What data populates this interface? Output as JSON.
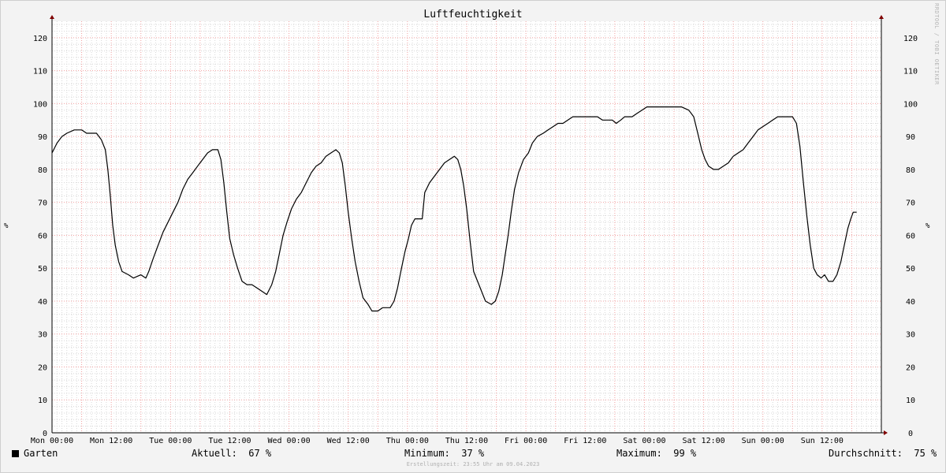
{
  "page": {
    "title": "Luftfeuchtigkeit",
    "watermark": "RRDTOOL / TOBI OETIKER",
    "unit": "%",
    "footer": "Erstellungszeit: 23:55 Uhr am 09.04.2023"
  },
  "legend": {
    "series": "Garten",
    "current_label": "Aktuell:",
    "current_value": "67 %",
    "min_label": "Minimum:",
    "min_value": "37 %",
    "max_label": "Maximum:",
    "max_value": "99 %",
    "avg_label": "Durchschnitt:",
    "avg_value": "75 %"
  },
  "colors": {
    "line": "#000000",
    "grid_minor": "#d8d8d8",
    "grid_major": "#f0a0a0",
    "axis_arrow": "#800000",
    "plot_bg": "#ffffff",
    "page_bg": "#f3f3f3"
  },
  "chart_data": {
    "type": "line",
    "title": "Luftfeuchtigkeit",
    "ylabel": "%",
    "ylim": [
      0,
      125
    ],
    "yticks": [
      0,
      10,
      20,
      30,
      40,
      50,
      60,
      70,
      80,
      90,
      100,
      110,
      120
    ],
    "xlim_hours": [
      0,
      168
    ],
    "xticks": [
      {
        "h": 0,
        "label": "Mon 00:00"
      },
      {
        "h": 12,
        "label": "Mon 12:00"
      },
      {
        "h": 24,
        "label": "Tue 00:00"
      },
      {
        "h": 36,
        "label": "Tue 12:00"
      },
      {
        "h": 48,
        "label": "Wed 00:00"
      },
      {
        "h": 60,
        "label": "Wed 12:00"
      },
      {
        "h": 72,
        "label": "Thu 00:00"
      },
      {
        "h": 84,
        "label": "Thu 12:00"
      },
      {
        "h": 96,
        "label": "Fri 00:00"
      },
      {
        "h": 108,
        "label": "Fri 12:00"
      },
      {
        "h": 120,
        "label": "Sat 00:00"
      },
      {
        "h": 132,
        "label": "Sat 12:00"
      },
      {
        "h": 144,
        "label": "Sun 00:00"
      },
      {
        "h": 156,
        "label": "Sun 12:00"
      }
    ],
    "grid": true,
    "series": [
      {
        "name": "Garten",
        "points": [
          [
            0,
            85
          ],
          [
            1,
            88
          ],
          [
            2,
            90
          ],
          [
            3,
            91
          ],
          [
            4.5,
            92
          ],
          [
            6,
            92
          ],
          [
            7,
            91
          ],
          [
            9,
            91
          ],
          [
            10,
            89
          ],
          [
            10.8,
            86
          ],
          [
            11.3,
            80
          ],
          [
            11.8,
            72
          ],
          [
            12.3,
            63
          ],
          [
            12.8,
            57
          ],
          [
            13.5,
            52
          ],
          [
            14.2,
            49
          ],
          [
            15.5,
            48
          ],
          [
            16.5,
            47
          ],
          [
            18,
            48
          ],
          [
            19,
            47
          ],
          [
            19.6,
            49
          ],
          [
            20.5,
            53
          ],
          [
            21.5,
            57
          ],
          [
            22.5,
            61
          ],
          [
            23.5,
            64
          ],
          [
            24.5,
            67
          ],
          [
            25.5,
            70
          ],
          [
            26.5,
            74
          ],
          [
            27.5,
            77
          ],
          [
            28.5,
            79
          ],
          [
            29.5,
            81
          ],
          [
            30.5,
            83
          ],
          [
            31.5,
            85
          ],
          [
            32.5,
            86
          ],
          [
            33.6,
            86
          ],
          [
            34.2,
            83
          ],
          [
            34.8,
            76
          ],
          [
            35.4,
            67
          ],
          [
            36,
            59
          ],
          [
            36.8,
            54
          ],
          [
            37.6,
            50
          ],
          [
            38.5,
            46
          ],
          [
            39.5,
            45
          ],
          [
            40.5,
            45
          ],
          [
            41.5,
            44
          ],
          [
            42.5,
            43
          ],
          [
            43.5,
            42
          ],
          [
            44.5,
            45
          ],
          [
            45.3,
            49
          ],
          [
            46,
            54
          ],
          [
            46.8,
            60
          ],
          [
            47.6,
            64
          ],
          [
            48.5,
            68
          ],
          [
            49.5,
            71
          ],
          [
            50.5,
            73
          ],
          [
            51.5,
            76
          ],
          [
            52.5,
            79
          ],
          [
            53.5,
            81
          ],
          [
            54.5,
            82
          ],
          [
            55.5,
            84
          ],
          [
            56.5,
            85
          ],
          [
            57.5,
            86
          ],
          [
            58.2,
            85
          ],
          [
            58.8,
            82
          ],
          [
            59.4,
            75
          ],
          [
            60,
            67
          ],
          [
            60.7,
            59
          ],
          [
            61.4,
            52
          ],
          [
            62.2,
            46
          ],
          [
            63,
            41
          ],
          [
            64,
            39
          ],
          [
            64.8,
            37
          ],
          [
            66,
            37
          ],
          [
            67,
            38
          ],
          [
            68.5,
            38
          ],
          [
            69.3,
            40
          ],
          [
            70,
            44
          ],
          [
            70.8,
            50
          ],
          [
            71.5,
            55
          ],
          [
            72.2,
            59
          ],
          [
            72.8,
            63
          ],
          [
            73.5,
            65
          ],
          [
            75,
            65
          ],
          [
            75.5,
            73
          ],
          [
            76.5,
            76
          ],
          [
            77.5,
            78
          ],
          [
            78.5,
            80
          ],
          [
            79.5,
            82
          ],
          [
            80.5,
            83
          ],
          [
            81.5,
            84
          ],
          [
            82.2,
            83
          ],
          [
            82.8,
            80
          ],
          [
            83.4,
            75
          ],
          [
            84,
            68
          ],
          [
            84.7,
            58
          ],
          [
            85.4,
            49
          ],
          [
            86.2,
            46
          ],
          [
            87,
            43
          ],
          [
            87.8,
            40
          ],
          [
            89,
            39
          ],
          [
            89.8,
            40
          ],
          [
            90.5,
            43
          ],
          [
            91.2,
            48
          ],
          [
            91.8,
            54
          ],
          [
            92.4,
            60
          ],
          [
            93,
            67
          ],
          [
            93.7,
            74
          ],
          [
            94.5,
            79
          ],
          [
            95.5,
            83
          ],
          [
            96.5,
            85
          ],
          [
            97.3,
            88
          ],
          [
            98.3,
            90
          ],
          [
            99.5,
            91
          ],
          [
            100.5,
            92
          ],
          [
            101.5,
            93
          ],
          [
            102.5,
            94
          ],
          [
            103.5,
            94
          ],
          [
            104.5,
            95
          ],
          [
            105.5,
            96
          ],
          [
            107,
            96
          ],
          [
            109,
            96
          ],
          [
            110.5,
            96
          ],
          [
            111.5,
            95
          ],
          [
            113.5,
            95
          ],
          [
            114.3,
            94
          ],
          [
            115.2,
            95
          ],
          [
            116,
            96
          ],
          [
            117.5,
            96
          ],
          [
            118.5,
            97
          ],
          [
            119.5,
            98
          ],
          [
            120.5,
            99
          ],
          [
            122,
            99
          ],
          [
            125,
            99
          ],
          [
            127.5,
            99
          ],
          [
            129,
            98
          ],
          [
            130,
            96
          ],
          [
            130.8,
            91
          ],
          [
            131.6,
            86
          ],
          [
            132.3,
            83
          ],
          [
            133,
            81
          ],
          [
            134,
            80
          ],
          [
            135,
            80
          ],
          [
            136,
            81
          ],
          [
            137,
            82
          ],
          [
            138,
            84
          ],
          [
            139,
            85
          ],
          [
            140,
            86
          ],
          [
            141,
            88
          ],
          [
            142,
            90
          ],
          [
            143,
            92
          ],
          [
            144,
            93
          ],
          [
            145,
            94
          ],
          [
            146,
            95
          ],
          [
            147,
            96
          ],
          [
            148.5,
            96
          ],
          [
            150,
            96
          ],
          [
            150.8,
            94
          ],
          [
            151.5,
            87
          ],
          [
            152.2,
            76
          ],
          [
            152.9,
            66
          ],
          [
            153.6,
            57
          ],
          [
            154.3,
            50
          ],
          [
            155,
            48
          ],
          [
            155.8,
            47
          ],
          [
            156.5,
            48
          ],
          [
            157.3,
            46
          ],
          [
            158.2,
            46
          ],
          [
            159,
            48
          ],
          [
            159.8,
            52
          ],
          [
            160.5,
            57
          ],
          [
            161.2,
            62
          ],
          [
            161.8,
            65
          ],
          [
            162.3,
            67
          ],
          [
            163,
            67
          ]
        ]
      }
    ]
  }
}
